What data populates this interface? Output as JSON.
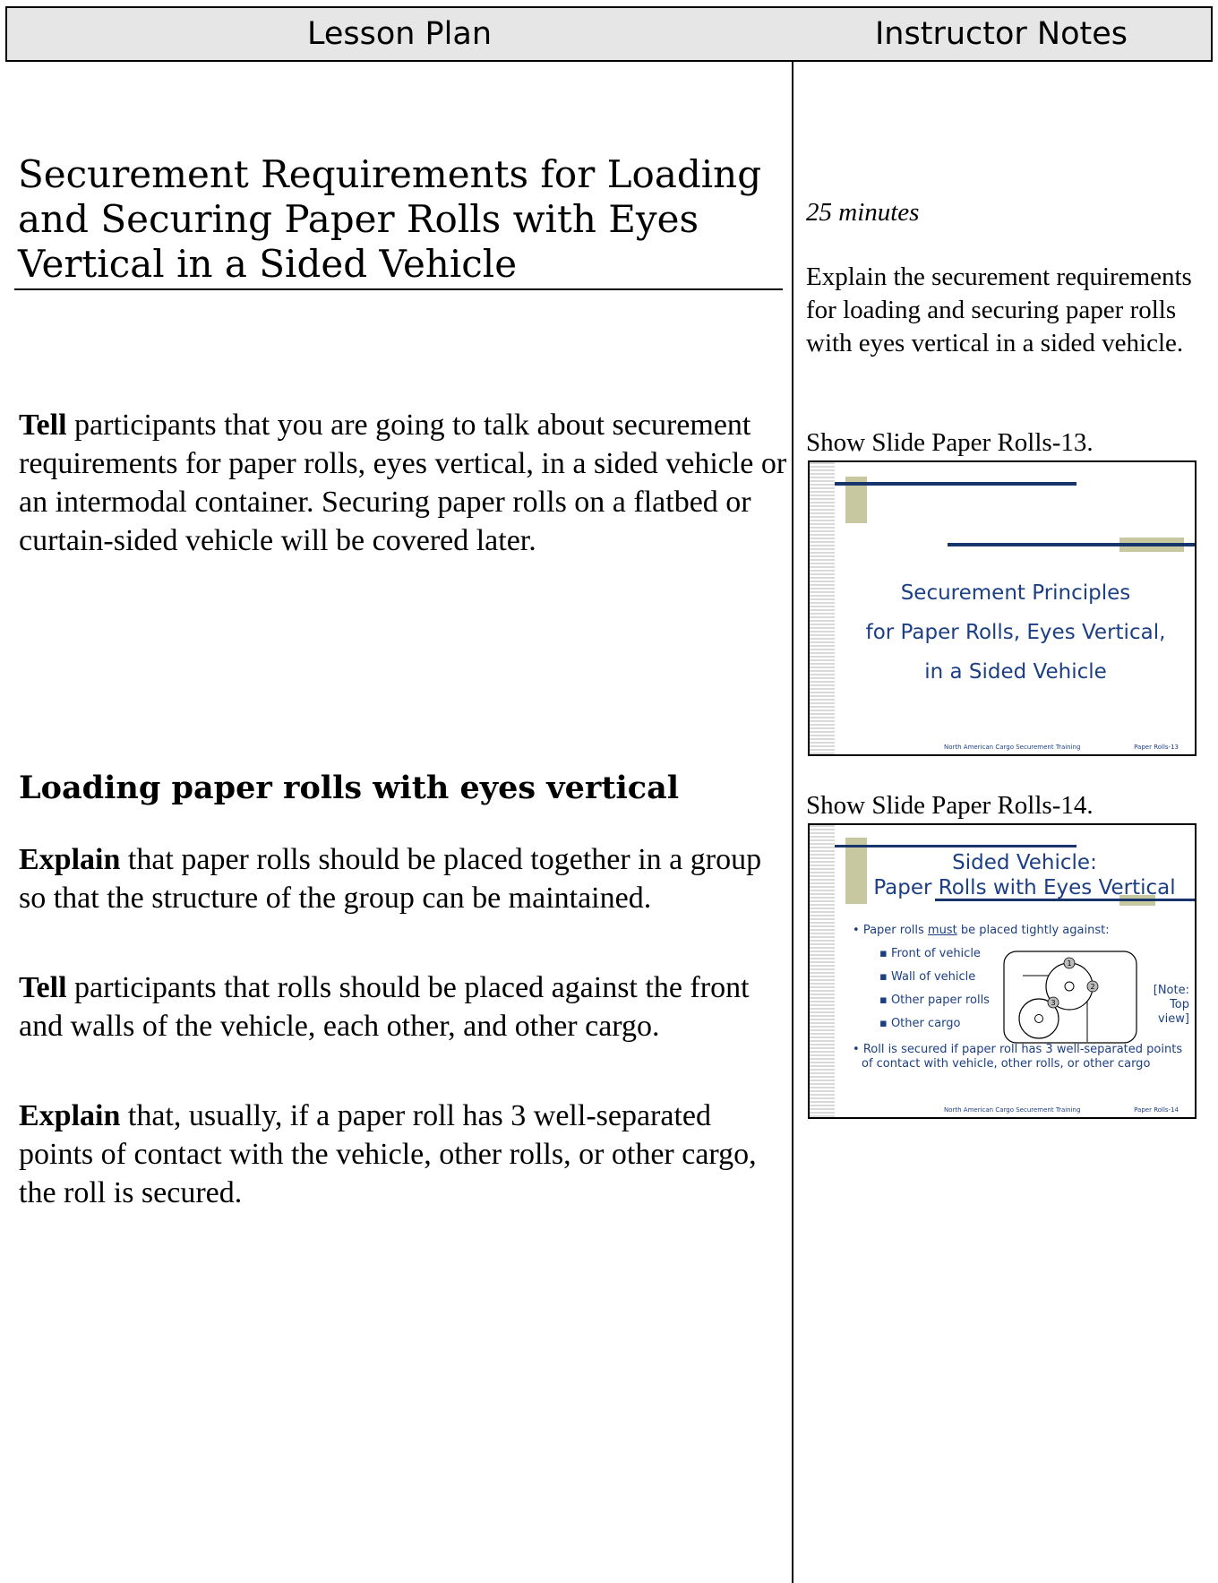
{
  "header": {
    "left": "Lesson Plan",
    "right": "Instructor Notes"
  },
  "lesson": {
    "title": "Securement Requirements for Loading and Securing Paper Rolls with Eyes Vertical in a Sided Vehicle",
    "intro_lead": "Tell",
    "intro_text": " participants that you are going to talk about securement requirements for paper rolls, eyes vertical, in a sided vehicle or an intermodal container.  Securing paper rolls on a flatbed or curtain-sided vehicle will be covered later.",
    "section_heading": "Loading paper rolls with eyes vertical",
    "p1_lead": "Explain",
    "p1_text": " that paper rolls should be placed together in a group so that the structure of the group can be maintained.",
    "p2_lead": "Tell",
    "p2_text": " participants that rolls should be placed against the front and walls of the vehicle, each other, and other cargo.",
    "p3_lead": "Explain",
    "p3_text": " that, usually, if a paper roll has 3 well-separated points of contact with the vehicle, other rolls, or other cargo, the roll is secured."
  },
  "notes": {
    "duration": "25 minutes",
    "explain": "Explain the securement requirements for loading and securing paper rolls with eyes vertical in a sided vehicle.",
    "show13": "Show Slide Paper Rolls-13.",
    "show14": "Show Slide Paper Rolls-14."
  },
  "slide13": {
    "title_line1": "Securement Principles",
    "title_line2": "for Paper Rolls, Eyes Vertical,",
    "title_line3": "in a Sided Vehicle",
    "footer_center": "North American Cargo Securement Training",
    "footer_right": "Paper Rolls-13"
  },
  "slide14": {
    "title_line1": "Sided Vehicle:",
    "title_line2": "Paper Rolls with Eyes Vertical",
    "bullet1_pre": "Paper rolls ",
    "bullet1_em": "must",
    "bullet1_post": " be placed tightly against:",
    "sub1": "Front of vehicle",
    "sub2": "Wall of vehicle",
    "sub3": "Other paper rolls",
    "sub4": "Other cargo",
    "note_line1": "[Note:",
    "note_line2": "Top",
    "note_line3": "view]",
    "bullet2_line1": "Roll is secured if paper roll has 3 well-separated points",
    "bullet2_line2": "of contact with vehicle, other rolls, or other cargo",
    "marker1": "1",
    "marker2": "2",
    "marker3": "3",
    "footer_center": "North American Cargo Securement Training",
    "footer_right": "Paper Rolls-14"
  }
}
